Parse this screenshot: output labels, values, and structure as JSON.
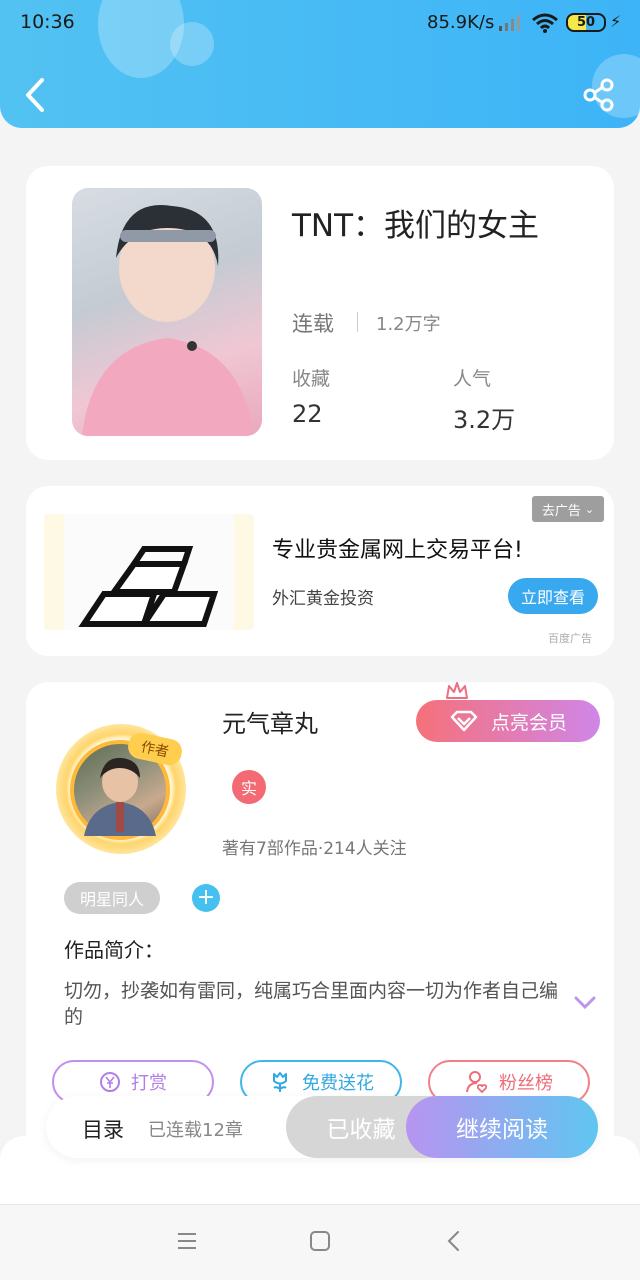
{
  "status_bar": {
    "time": "10:36",
    "net_speed": "85.9K/s",
    "battery": "50"
  },
  "header": {
    "back_icon": "chevron-left-icon",
    "share_icon": "share-icon",
    "accent": "#3db4f7"
  },
  "book": {
    "title": "TNT：我们的女主",
    "status": "连载",
    "word_count": "1.2万字",
    "favorites_label": "收藏",
    "favorites_value": "22",
    "popularity_label": "人气",
    "popularity_value": "3.2万"
  },
  "ad": {
    "dismiss_label": "去广告",
    "title": "专业贵金属网上交易平台!",
    "subtitle": "外汇黄金投资",
    "cta": "立即查看",
    "source": "百度广告"
  },
  "author": {
    "badge": "作者",
    "name": "元气章丸",
    "real_badge": "实",
    "stats": "著有7部作品·214人关注",
    "vip_button": "点亮会员",
    "tag": "明星同人",
    "intro_title": "作品简介：",
    "intro_text": "切勿，抄袭如有雷同，纯属巧合里面内容一切为作者自己编的",
    "actions": {
      "reward": "打赏",
      "flower": "免费送花",
      "fans": "粉丝榜"
    }
  },
  "bottom_bar": {
    "toc_label": "目录",
    "toc_info": "已连载12章",
    "collected": "已收藏",
    "continue": "继续阅读"
  },
  "nav": {
    "menu_icon": "menu-icon",
    "home_icon": "home-square-icon",
    "back_icon": "back-triangle-icon"
  }
}
